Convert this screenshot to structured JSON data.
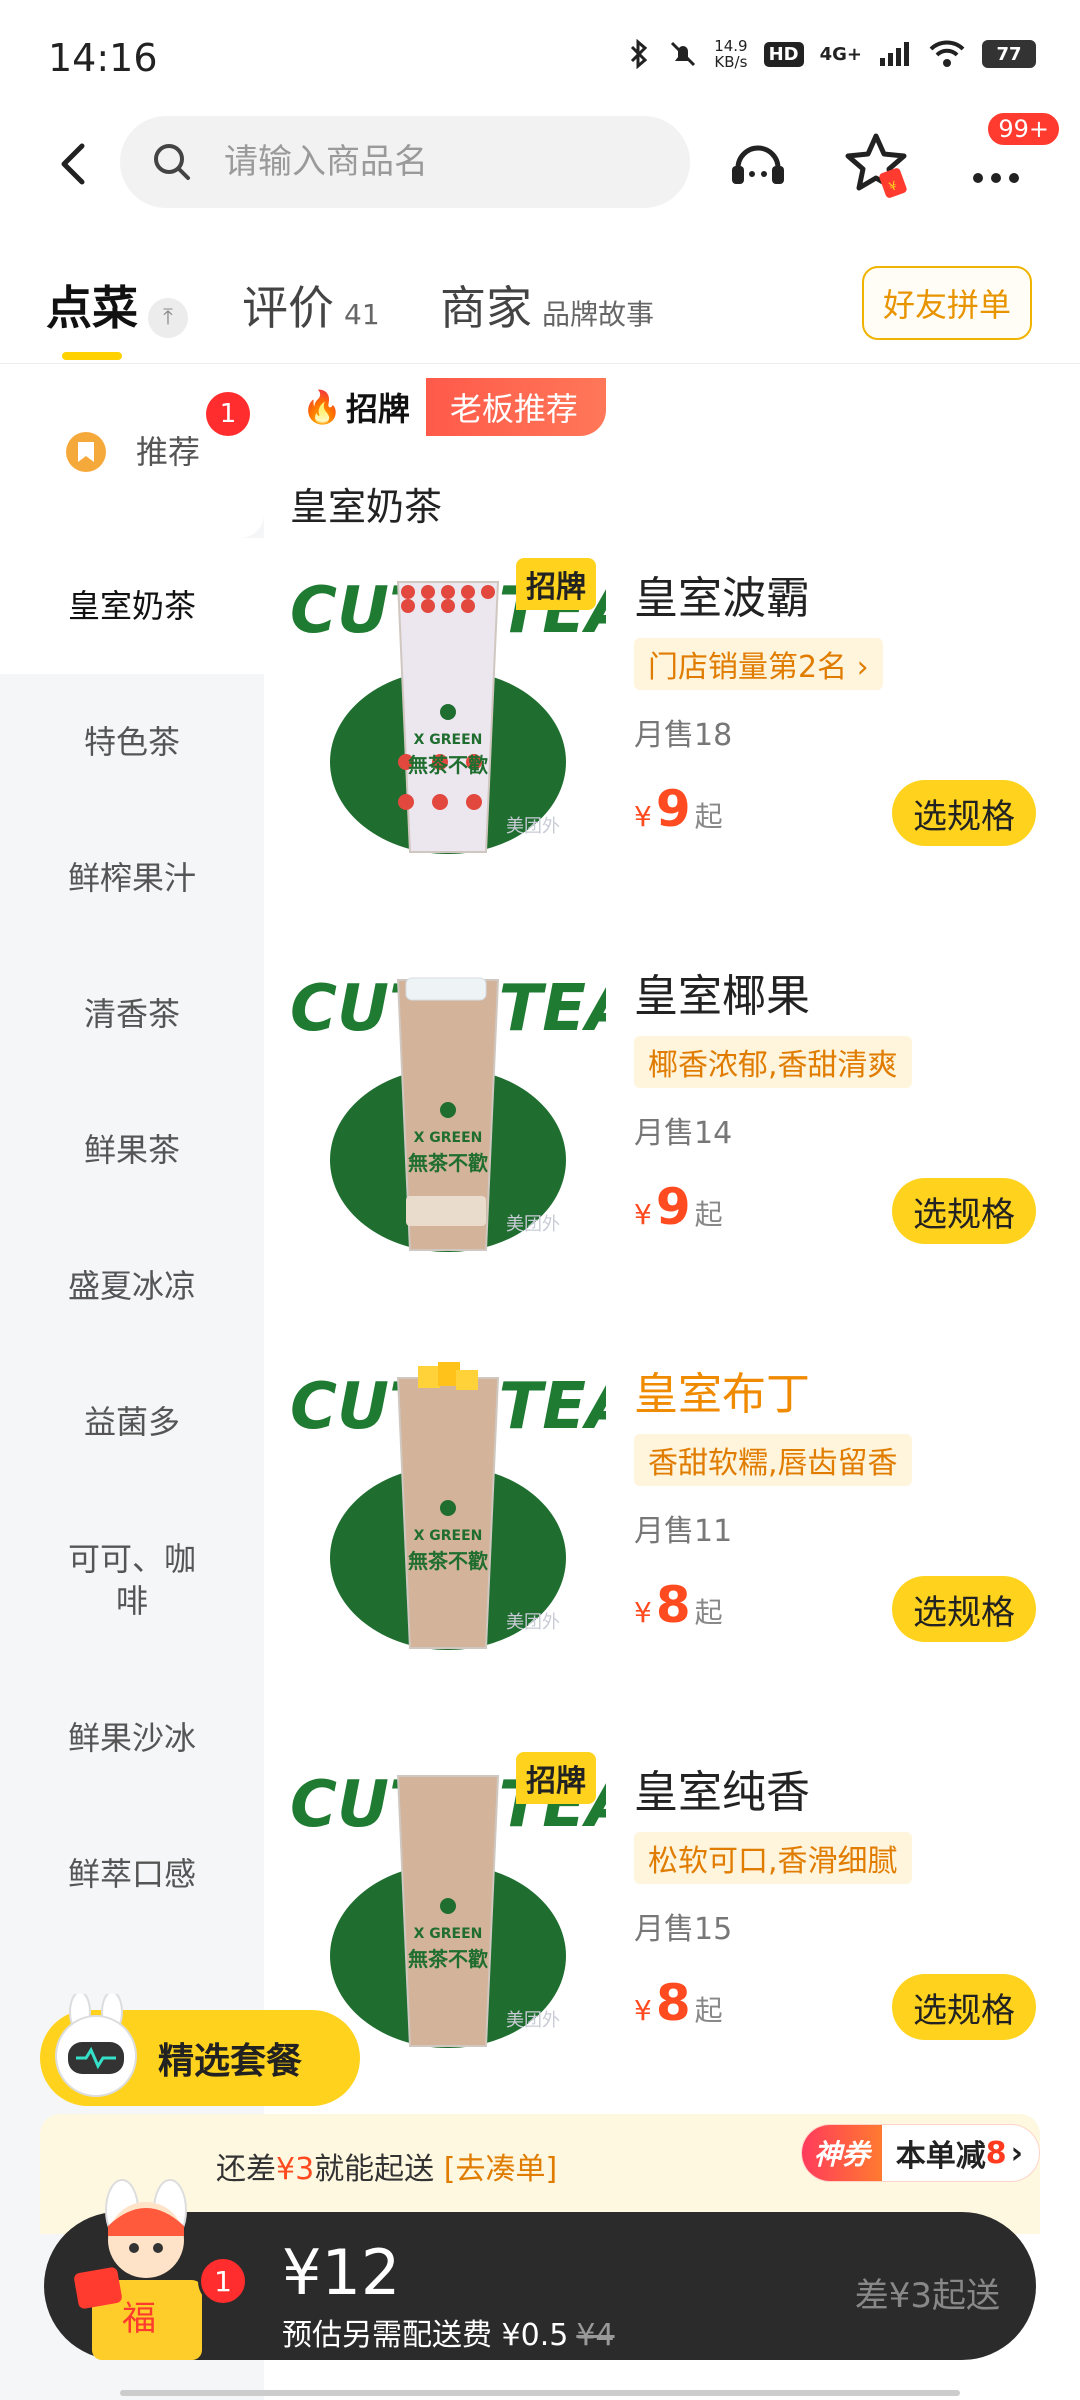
{
  "status_bar": {
    "time": "14:16",
    "net_speed": "14.9\nKB/s",
    "hd": "HD",
    "network": "4G+",
    "battery": "77"
  },
  "top_bar": {
    "search_placeholder": "请输入商品名",
    "more_badge": "99+"
  },
  "tabs": [
    {
      "label": "点菜",
      "sub": ""
    },
    {
      "label": "评价",
      "sub": "41"
    },
    {
      "label": "商家",
      "sub": "品牌故事"
    }
  ],
  "friend_order_label": "好友拼单",
  "sidebar": {
    "items": [
      {
        "label": "推荐",
        "badge": "1"
      },
      {
        "label": "皇室奶茶"
      },
      {
        "label": "特色茶"
      },
      {
        "label": "鲜榨果汁"
      },
      {
        "label": "清香茶"
      },
      {
        "label": "鲜果茶"
      },
      {
        "label": "盛夏冰凉"
      },
      {
        "label": "益菌多"
      },
      {
        "label": "可可、咖\n啡"
      },
      {
        "label": "鲜果沙冰"
      },
      {
        "label": "鲜萃口感"
      }
    ]
  },
  "banner": {
    "left": "招牌",
    "right": "老板推荐"
  },
  "section_title": "皇室奶茶",
  "image_text": {
    "brand": "CUTE TEA",
    "cup_text": "無茶不歡",
    "cup_brand": "X GREEN",
    "watermark": "美团外"
  },
  "products": [
    {
      "name": "皇室波霸",
      "tag": "门店销量第2名 ›",
      "sales": "月售18",
      "price": "9",
      "signature": "招牌",
      "name_color": "#222222",
      "topping": "boba"
    },
    {
      "name": "皇室椰果",
      "tag": "椰香浓郁,香甜清爽",
      "sales": "月售14",
      "price": "9",
      "signature": "",
      "name_color": "#222222",
      "topping": "coconut"
    },
    {
      "name": "皇室布丁",
      "tag": "香甜软糯,唇齿留香",
      "sales": "月售11",
      "price": "8",
      "signature": "",
      "name_color": "#f08a00",
      "topping": "pudding"
    },
    {
      "name": "皇室纯香",
      "tag": "松软可口,香滑细腻",
      "sales": "月售15",
      "price": "8",
      "signature": "招牌",
      "name_color": "#222222",
      "topping": "plain"
    }
  ],
  "product_labels": {
    "currency": "¥",
    "qi": "起",
    "spec_button": "选规格"
  },
  "combo_label": "精选套餐",
  "promo": {
    "prefix": "还差",
    "amount": "¥3",
    "suffix": "就能起送",
    "link": "[去凑单]",
    "coupon_left": "神券",
    "coupon_right": "本单减",
    "coupon_amount": "8",
    "coupon_arrow": "›"
  },
  "cart": {
    "badge": "1",
    "total": "¥12",
    "fee_text": "预估另需配送费 ¥0.5",
    "fee_original": "¥4",
    "diff_text": "差¥3起送",
    "mascot_text": "福"
  },
  "colors": {
    "accent": "#ffd31d",
    "price": "#ff4b1f",
    "brand_green": "#1f7a32"
  }
}
